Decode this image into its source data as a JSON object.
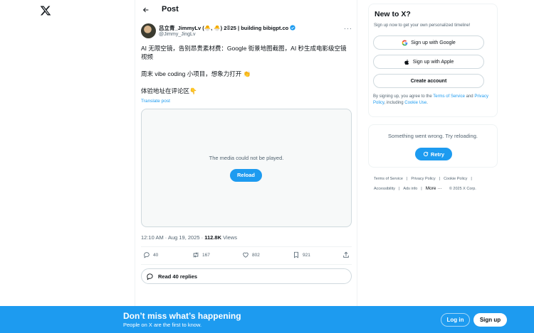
{
  "header": {
    "title": "Post"
  },
  "tweet": {
    "author_name": "吕立青_JimmyLv (🐣, 🐣) 2𝟘25 | building bibigpt.co",
    "author_handle": "@Jimmy_JingLv",
    "text_1": "AI 无限空镜，告别昂贵素材费：Google 街景地图截图，AI 秒生成电影级空镜视频",
    "text_2": "周末 vibe coding 小项目，想象力打开 👏",
    "text_3": "体验地址在评论区👇",
    "translate_label": "Translate post",
    "media_message": "The media could not be played.",
    "reload_label": "Reload",
    "time": "12:10 AM · Aug 19, 2025 · ",
    "views_count": "112.8K",
    "views_label": " Views",
    "replies": "40",
    "retweets": "167",
    "likes": "802",
    "bookmarks": "921",
    "read_replies_label": "Read 40 replies"
  },
  "signup_card": {
    "title": "New to X?",
    "subtitle": "Sign up now to get your own personalized timeline!",
    "google_label": "Sign up with Google",
    "apple_label": "Sign up with Apple",
    "create_label": "Create account",
    "terms_prefix": "By signing up, you agree to the ",
    "terms_link": "Terms of Service",
    "terms_and": " and ",
    "privacy_link": "Privacy Policy",
    "terms_including": ", including ",
    "cookie_link": "Cookie Use",
    "terms_end": "."
  },
  "error_card": {
    "message": "Something went wrong. Try reloading.",
    "retry_label": "Retry"
  },
  "footer": {
    "terms": "Terms of Service",
    "privacy": "Privacy Policy",
    "cookie": "Cookie Policy",
    "accessibility": "Accessibility",
    "ads": "Ads info",
    "more": "More ···",
    "copyright": "© 2025 X Corp."
  },
  "banner": {
    "title": "Don’t miss what’s happening",
    "subtitle": "People on X are the first to know.",
    "login_label": "Log in",
    "signup_label": "Sign up"
  },
  "colors": {
    "accent": "#1d9bf0",
    "text": "#0f1419",
    "muted": "#536471",
    "border": "#cfd9de"
  }
}
